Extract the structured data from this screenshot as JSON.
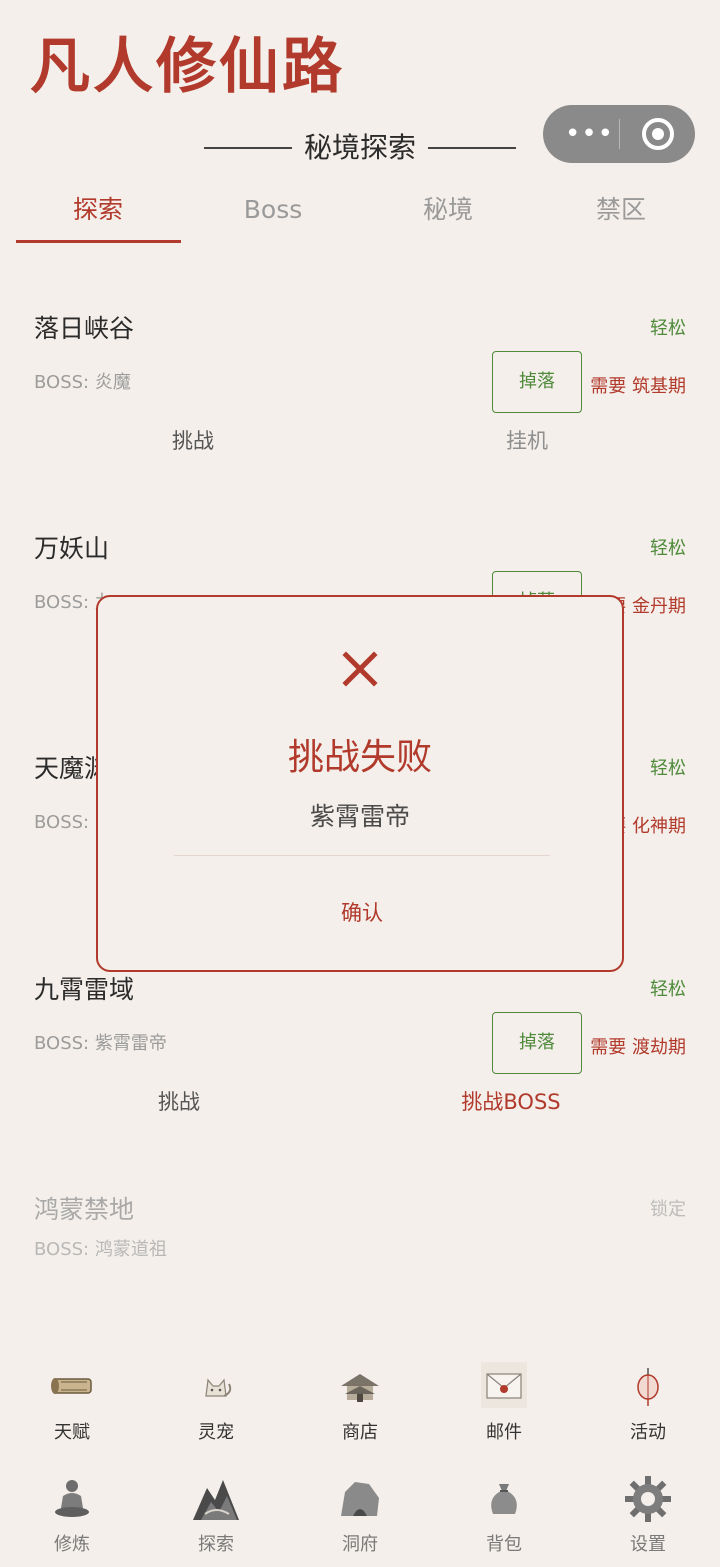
{
  "header": {
    "app_title": "凡人修仙路",
    "section_title": "秘境探索"
  },
  "tabs": [
    {
      "label": "探索",
      "active": true
    },
    {
      "label": "Boss",
      "active": false
    },
    {
      "label": "秘境",
      "active": false
    },
    {
      "label": "禁区",
      "active": false
    }
  ],
  "areas": [
    {
      "name": "落日峡谷",
      "difficulty": "轻松",
      "boss": "BOSS: 炎魔",
      "drop_label": "掉落",
      "requirement": "需要 筑基期",
      "action_left": "挑战",
      "action_right": "挂机"
    },
    {
      "name": "万妖山",
      "difficulty": "轻松",
      "boss": "BOSS: 九",
      "drop_label": "掉落",
      "requirement": "需要 金丹期"
    },
    {
      "name": "天魔渊",
      "difficulty": "轻松",
      "boss": "BOSS: 天",
      "requirement": "需要 化神期"
    },
    {
      "name": "九霄雷域",
      "difficulty": "轻松",
      "boss": "BOSS: 紫霄雷帝",
      "drop_label": "掉落",
      "requirement": "需要 渡劫期",
      "action_left": "挑战",
      "action_right": "挑战BOSS"
    },
    {
      "name": "鸿蒙禁地",
      "difficulty": "锁定",
      "boss": "BOSS: 鸿蒙道祖"
    }
  ],
  "modal": {
    "icon": "close-x-icon",
    "title": "挑战失败",
    "subtitle": "紫霄雷帝",
    "confirm_label": "确认"
  },
  "nav_top": [
    {
      "label": "天赋",
      "icon": "scroll-icon"
    },
    {
      "label": "灵宠",
      "icon": "fox-pet-icon"
    },
    {
      "label": "商店",
      "icon": "pavilion-icon"
    },
    {
      "label": "邮件",
      "icon": "envelope-icon"
    },
    {
      "label": "活动",
      "icon": "lantern-icon"
    }
  ],
  "nav_bottom": [
    {
      "label": "修炼",
      "icon": "meditation-icon"
    },
    {
      "label": "探索",
      "icon": "mountain-icon"
    },
    {
      "label": "洞府",
      "icon": "cave-rock-icon"
    },
    {
      "label": "背包",
      "icon": "bag-icon"
    },
    {
      "label": "设置",
      "icon": "gear-icon"
    }
  ],
  "colors": {
    "background": "#f4efea",
    "accent": "#b13a2c",
    "easy_green": "#4e8a3a",
    "muted": "#9c9c9c"
  }
}
